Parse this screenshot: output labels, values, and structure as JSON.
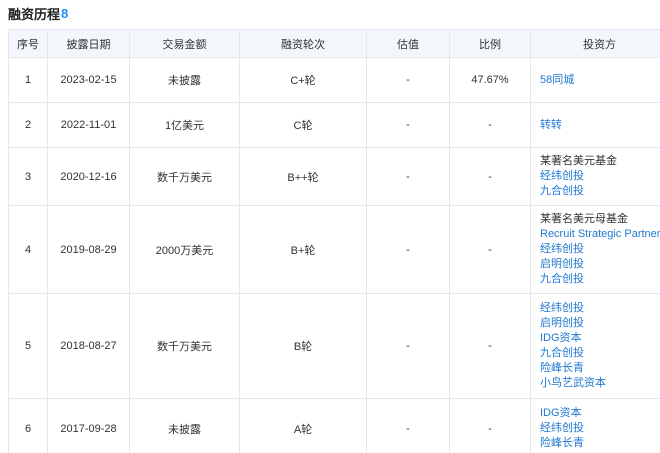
{
  "section": {
    "title": "融资历程",
    "count": "8"
  },
  "columns": [
    "序号",
    "披露日期",
    "交易金额",
    "融资轮次",
    "估值",
    "比例",
    "投资方"
  ],
  "rows": [
    {
      "index": "1",
      "date": "2023-02-15",
      "amount": "未披露",
      "round": "C+轮",
      "valuation": "-",
      "ratio": "47.67%",
      "investors": [
        {
          "name": "58同城",
          "link": true
        }
      ]
    },
    {
      "index": "2",
      "date": "2022-11-01",
      "amount": "1亿美元",
      "round": "C轮",
      "valuation": "-",
      "ratio": "-",
      "investors": [
        {
          "name": "转转",
          "link": true
        }
      ]
    },
    {
      "index": "3",
      "date": "2020-12-16",
      "amount": "数千万美元",
      "round": "B++轮",
      "valuation": "-",
      "ratio": "-",
      "investors": [
        {
          "name": "某著名美元基金",
          "link": false
        },
        {
          "name": "经纬创投",
          "link": true
        },
        {
          "name": "九合创投",
          "link": true
        }
      ]
    },
    {
      "index": "4",
      "date": "2019-08-29",
      "amount": "2000万美元",
      "round": "B+轮",
      "valuation": "-",
      "ratio": "-",
      "investors": [
        {
          "name": "某著名美元母基金",
          "link": false
        },
        {
          "name": "Recruit Strategic Partners",
          "link": true
        },
        {
          "name": "经纬创投",
          "link": true
        },
        {
          "name": "启明创投",
          "link": true
        },
        {
          "name": "九合创投",
          "link": true
        }
      ]
    },
    {
      "index": "5",
      "date": "2018-08-27",
      "amount": "数千万美元",
      "round": "B轮",
      "valuation": "-",
      "ratio": "-",
      "investors": [
        {
          "name": "经纬创投",
          "link": true
        },
        {
          "name": "启明创投",
          "link": true
        },
        {
          "name": "IDG资本",
          "link": true
        },
        {
          "name": "九合创投",
          "link": true
        },
        {
          "name": "险峰长青",
          "link": true
        },
        {
          "name": "小鸟艺武资本",
          "link": true
        }
      ]
    },
    {
      "index": "6",
      "date": "2017-09-28",
      "amount": "未披露",
      "round": "A轮",
      "valuation": "-",
      "ratio": "-",
      "investors": [
        {
          "name": "IDG资本",
          "link": true
        },
        {
          "name": "经纬创投",
          "link": true
        },
        {
          "name": "险峰长青",
          "link": true
        }
      ]
    }
  ]
}
